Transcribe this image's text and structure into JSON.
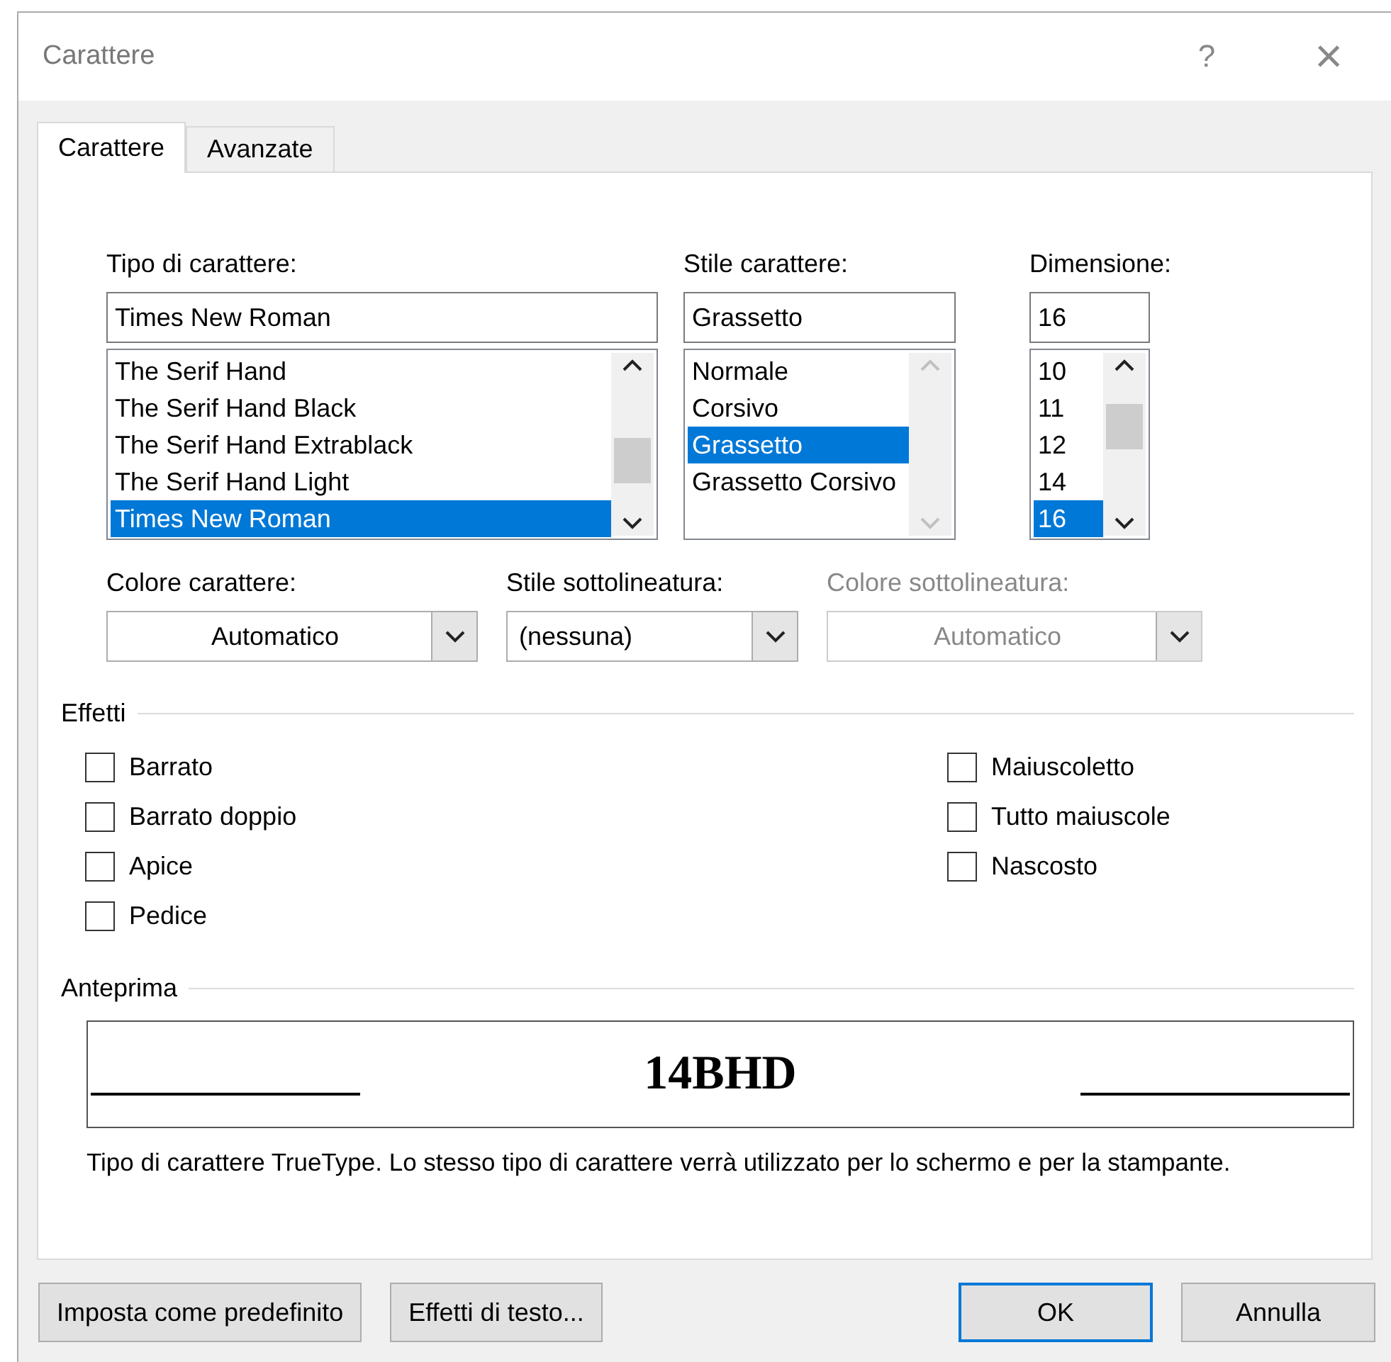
{
  "window": {
    "title": "Carattere",
    "help": "?",
    "close": "×"
  },
  "tabs": [
    {
      "label": "Carattere",
      "selected": true
    },
    {
      "label": "Avanzate",
      "selected": false
    }
  ],
  "pickers": [
    {
      "label": "Tipo di carattere:",
      "value": "Times New Roman",
      "scrollable": true,
      "items": [
        {
          "text": "The Serif Hand",
          "selected": false
        },
        {
          "text": "The Serif Hand Black",
          "selected": false
        },
        {
          "text": "The Serif Hand Extrablack",
          "selected": false
        },
        {
          "text": "The Serif Hand Light",
          "selected": false
        },
        {
          "text": "Times New Roman",
          "selected": true
        }
      ]
    },
    {
      "label": "Stile carattere:",
      "value": "Grassetto",
      "scrollable": false,
      "items": [
        {
          "text": "Normale",
          "selected": false
        },
        {
          "text": "Corsivo",
          "selected": false
        },
        {
          "text": "Grassetto",
          "selected": true
        },
        {
          "text": "Grassetto Corsivo",
          "selected": false
        }
      ]
    },
    {
      "label": "Dimensione:",
      "value": "16",
      "scrollable": true,
      "items": [
        {
          "text": "10",
          "selected": false
        },
        {
          "text": "11",
          "selected": false
        },
        {
          "text": "12",
          "selected": false
        },
        {
          "text": "14",
          "selected": false
        },
        {
          "text": "16",
          "selected": true
        }
      ]
    }
  ],
  "dropdowns": [
    {
      "label": "Colore carattere:",
      "value": "Automatico",
      "centered": true,
      "disabled": false
    },
    {
      "label": "Stile sottolineatura:",
      "value": "(nessuna)",
      "centered": false,
      "disabled": false
    },
    {
      "label": "Colore sottolineatura:",
      "value": "Automatico",
      "centered": true,
      "disabled": true
    }
  ],
  "effects": {
    "title": "Effetti",
    "left": [
      {
        "label": "Barrato",
        "checked": false
      },
      {
        "label": "Barrato doppio",
        "checked": false
      },
      {
        "label": "Apice",
        "checked": false
      },
      {
        "label": "Pedice",
        "checked": false
      }
    ],
    "right": [
      {
        "label": "Maiuscoletto",
        "checked": false
      },
      {
        "label": "Tutto maiuscole",
        "checked": false
      },
      {
        "label": "Nascosto",
        "checked": false
      }
    ]
  },
  "preview": {
    "title": "Anteprima",
    "sample": "14BHD",
    "description": "Tipo di carattere TrueType. Lo stesso tipo di carattere verrà utilizzato per lo schermo e per la stampante."
  },
  "buttons": [
    {
      "label": "Imposta come predefinito",
      "default": false
    },
    {
      "label": "Effetti di testo...",
      "default": false
    },
    {
      "label": "OK",
      "default": true
    },
    {
      "label": "Annulla",
      "default": false
    }
  ]
}
